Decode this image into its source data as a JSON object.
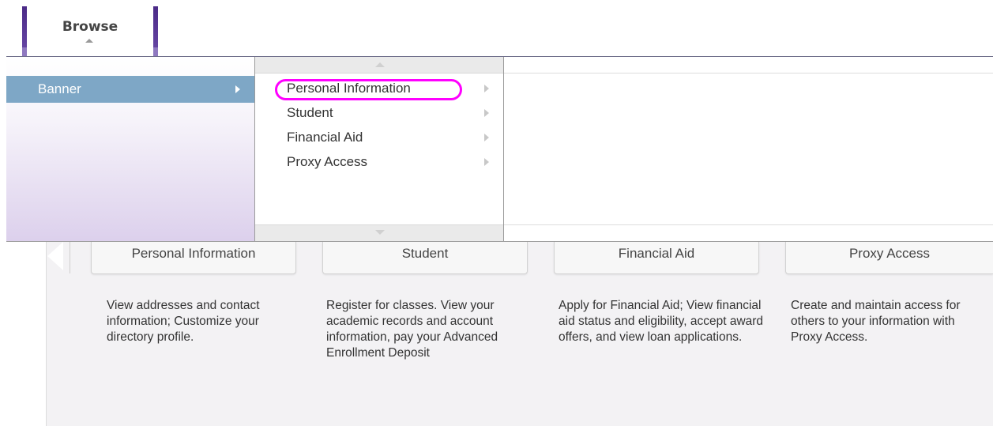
{
  "tab": {
    "label": "Browse"
  },
  "menu": {
    "level1": [
      {
        "label": "Banner"
      }
    ],
    "level2": [
      {
        "label": "Personal Information"
      },
      {
        "label": "Student"
      },
      {
        "label": "Financial Aid"
      },
      {
        "label": "Proxy Access"
      }
    ]
  },
  "categories": [
    {
      "title": "Personal Information",
      "description": "View addresses and contact information; Customize your directory profile."
    },
    {
      "title": "Student",
      "description": "Register for classes. View your academic records and account information, pay your Advanced Enrollment Deposit"
    },
    {
      "title": "Financial Aid",
      "description": "Apply for Financial Aid; View financial aid status and eligibility, accept award offers, and view loan applications."
    },
    {
      "title": "Proxy Access",
      "description": "Create and maintain access for others to your information with Proxy Access."
    }
  ],
  "colors": {
    "accent": "#7ea7c6",
    "highlight": "#ff00ff",
    "tab_bar": "#4b2a87"
  }
}
